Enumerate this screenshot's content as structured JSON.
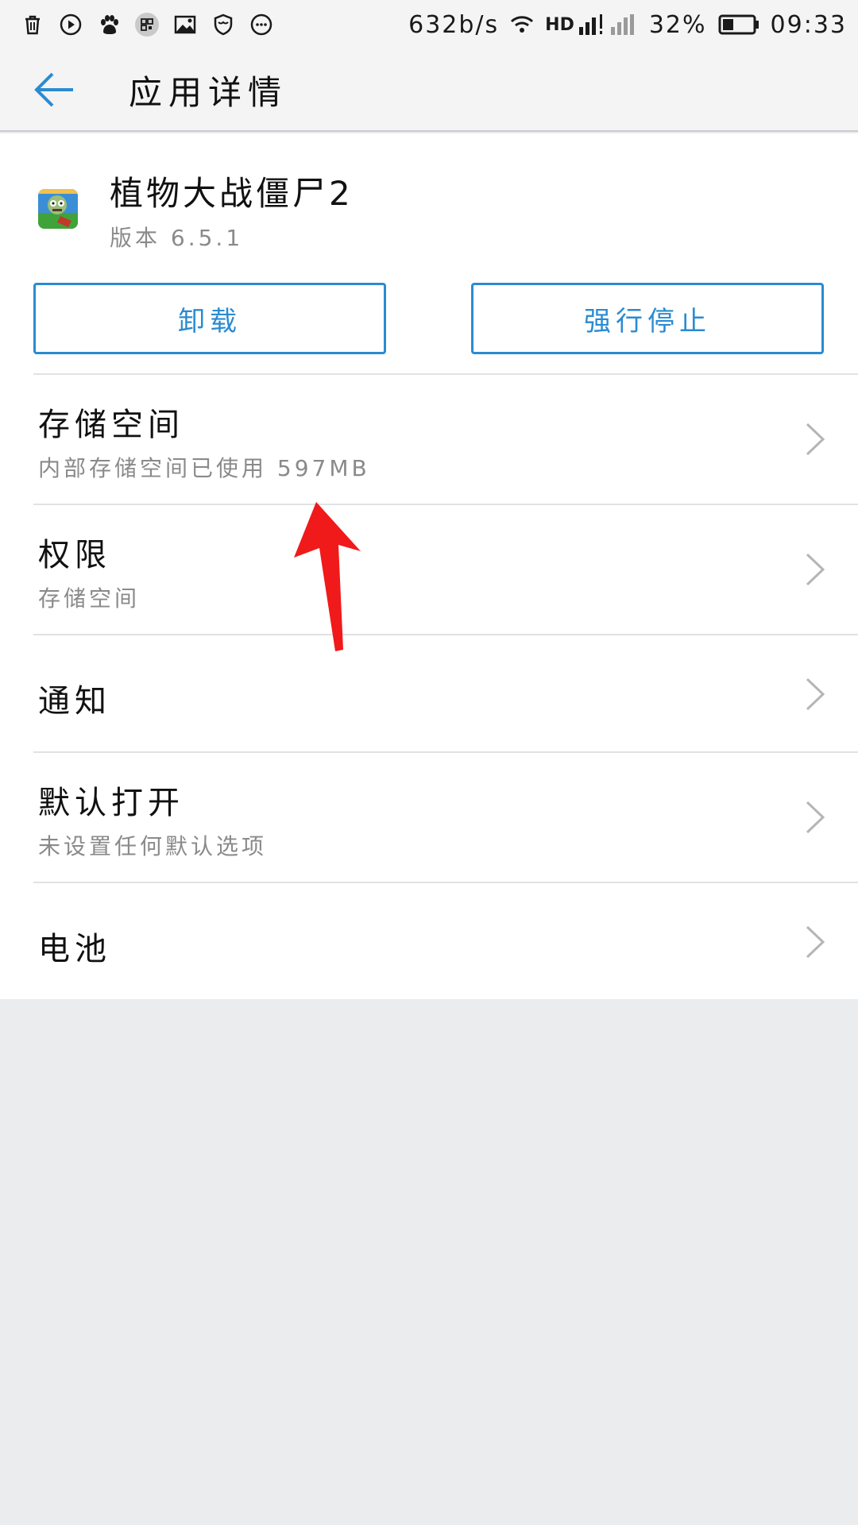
{
  "status_bar": {
    "net_speed": "632b/s",
    "network_label": "HD",
    "battery_percent": "32%",
    "time": "09:33",
    "icons": [
      "trash-icon",
      "play-icon",
      "paw-icon",
      "qr-icon",
      "image-icon",
      "shield-icon",
      "more-icon"
    ]
  },
  "header": {
    "title": "应用详情",
    "back_icon": "arrow-left-icon"
  },
  "app": {
    "name": "植物大战僵尸2",
    "version": "版本 6.5.1"
  },
  "buttons": {
    "uninstall": "卸载",
    "force_stop": "强行停止"
  },
  "rows": [
    {
      "title": "存储空间",
      "subtitle": "内部存储空间已使用 597MB"
    },
    {
      "title": "权限",
      "subtitle": "存储空间"
    },
    {
      "title": "通知"
    },
    {
      "title": "默认打开",
      "subtitle": "未设置任何默认选项"
    },
    {
      "title": "电池"
    }
  ],
  "colors": {
    "accent": "#2b8bd1",
    "background": "#ebecee",
    "annotation_arrow": "#f01a1a"
  }
}
